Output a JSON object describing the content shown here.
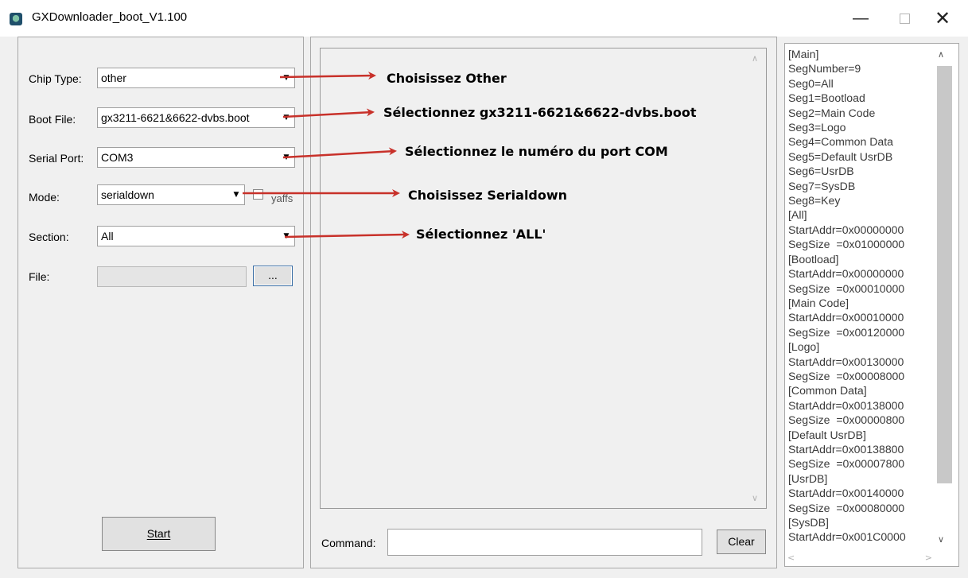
{
  "window": {
    "title": "GXDownloader_boot_V1.100",
    "icon": "app-globe-icon",
    "controls": {
      "minimize": "—",
      "close": "✕"
    }
  },
  "form": {
    "chip_type": {
      "label": "Chip Type:",
      "value": "other"
    },
    "boot_file": {
      "label": "Boot File:",
      "value": "gx3211-6621&6622-dvbs.boot"
    },
    "serial_port": {
      "label": "Serial Port:",
      "value": "COM3"
    },
    "mode": {
      "label": "Mode:",
      "value": "serialdown",
      "yaffs_label": "yaffs",
      "yaffs_checked": false
    },
    "section": {
      "label": "Section:",
      "value": "All"
    },
    "file": {
      "label": "File:",
      "value": "",
      "browse_label": "..."
    },
    "start_label": "Start"
  },
  "console": {
    "command_label": "Command:",
    "command_value": "",
    "clear_label": "Clear"
  },
  "config_lines": [
    "[Main]",
    "SegNumber=9",
    "Seg0=All",
    "Seg1=Bootload",
    "Seg2=Main Code",
    "Seg3=Logo",
    "Seg4=Common Data",
    "Seg5=Default UsrDB",
    "Seg6=UsrDB",
    "Seg7=SysDB",
    "Seg8=Key",
    "[All]",
    "StartAddr=0x00000000",
    "SegSize  =0x01000000",
    "[Bootload]",
    "StartAddr=0x00000000",
    "SegSize  =0x00010000",
    "[Main Code]",
    "StartAddr=0x00010000",
    "SegSize  =0x00120000",
    "[Logo]",
    "StartAddr=0x00130000",
    "SegSize  =0x00008000",
    "[Common Data]",
    "StartAddr=0x00138000",
    "SegSize  =0x00000800",
    "[Default UsrDB]",
    "StartAddr=0x00138800",
    "SegSize  =0x00007800",
    "[UsrDB]",
    "StartAddr=0x00140000",
    "SegSize  =0x00080000",
    "[SysDB]",
    "StartAddr=0x001C0000"
  ],
  "annotations": {
    "chip_type": "Choisissez Other",
    "boot_file": "Sélectionnez gx3211-6621&6622-dvbs.boot",
    "serial_port": "Sélectionnez le numéro du port COM",
    "mode": "Choisissez Serialdown",
    "section": "Sélectionnez 'ALL'"
  },
  "colors": {
    "arrow": "#c8312a",
    "window_bg": "#f0f0f0",
    "scroll_thumb": "#c8c8c8"
  }
}
